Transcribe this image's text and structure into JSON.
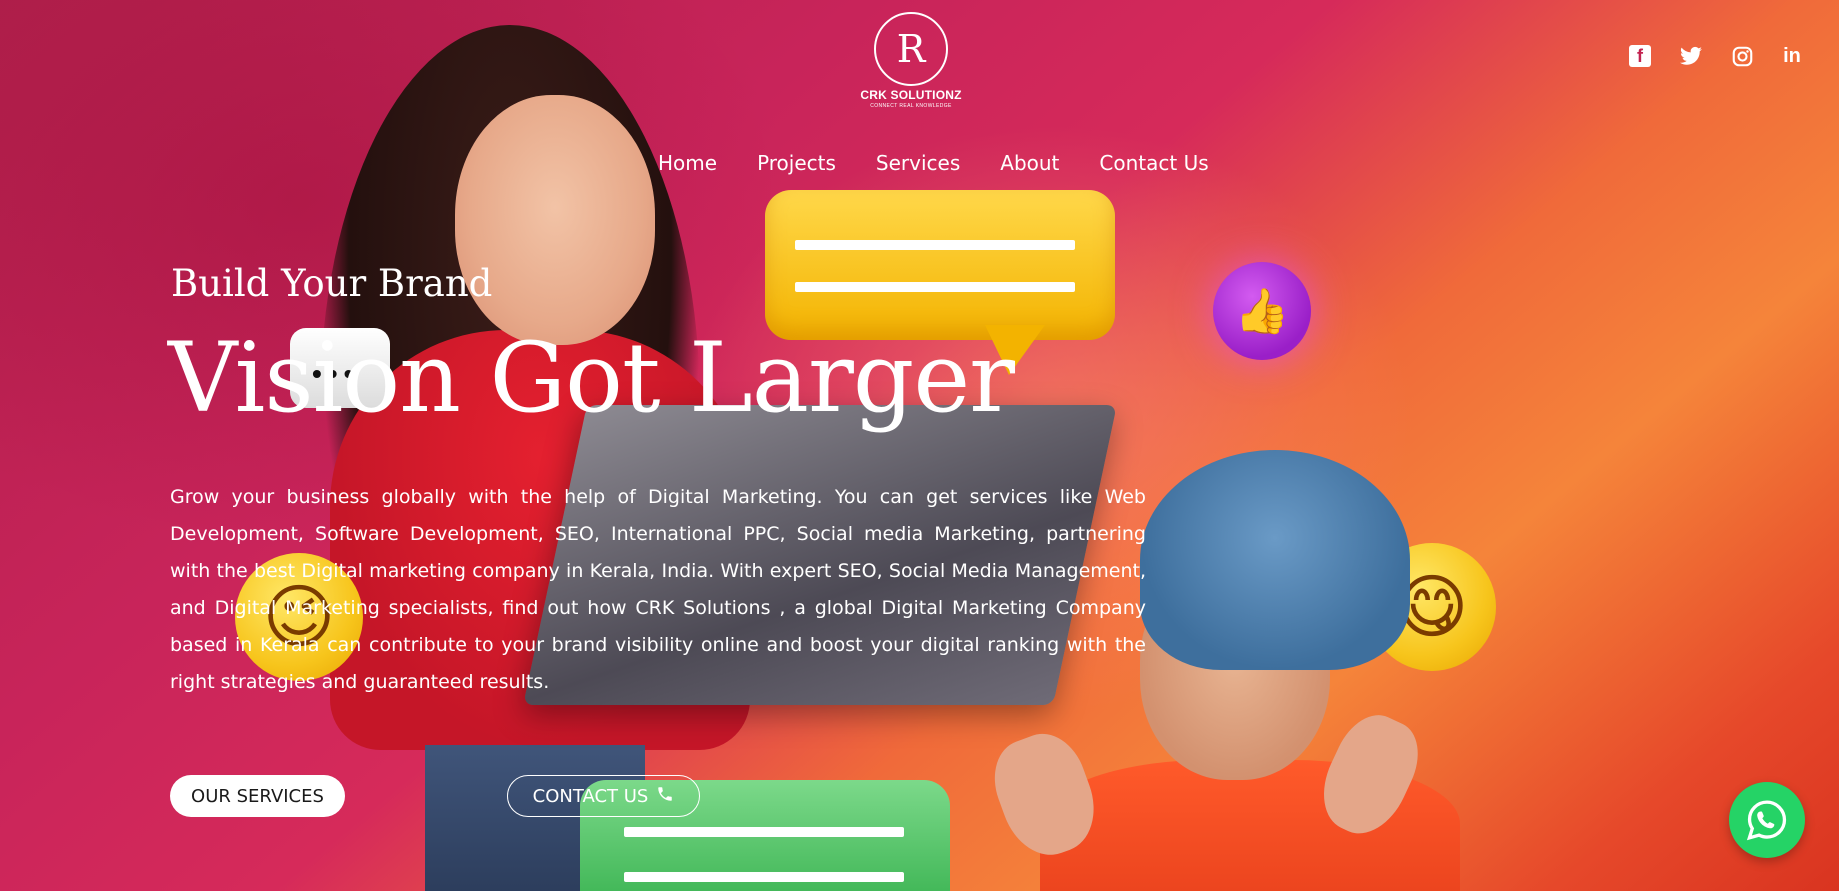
{
  "brand": {
    "name": "CRK SOLUTIONZ",
    "tagline": "CONNECT REAL KNOWLEDGE",
    "mark": "R"
  },
  "social": [
    {
      "name": "facebook-icon",
      "glyph": "f"
    },
    {
      "name": "twitter-icon",
      "glyph": "t"
    },
    {
      "name": "instagram-icon",
      "glyph": "◎"
    },
    {
      "name": "linkedin-icon",
      "glyph": "in"
    }
  ],
  "nav": {
    "items": [
      "Home",
      "Projects",
      "Services",
      "About",
      "Contact Us"
    ]
  },
  "hero": {
    "kicker": "Build Your Brand",
    "headline": "Vision Got Larger",
    "description": "Grow your business globally with the help of Digital Marketing. You can get services like Web Development, Software Development,  SEO, International PPC, Social media Marketing, partnering with the best Digital marketing company in Kerala, India. With expert SEO, Social Media Management, and Digital Marketing specialists, find out how CRK Solutions , a global Digital Marketing Company based in Kerala can contribute to your brand visibility online and boost your digital ranking with the right strategies and guaranteed results."
  },
  "buttons": {
    "services": "OUR SERVICES",
    "contact": "CONTACT US"
  },
  "colors": {
    "gradient_start": "#b01f4b",
    "gradient_end": "#d93420",
    "whatsapp": "#25d366"
  }
}
